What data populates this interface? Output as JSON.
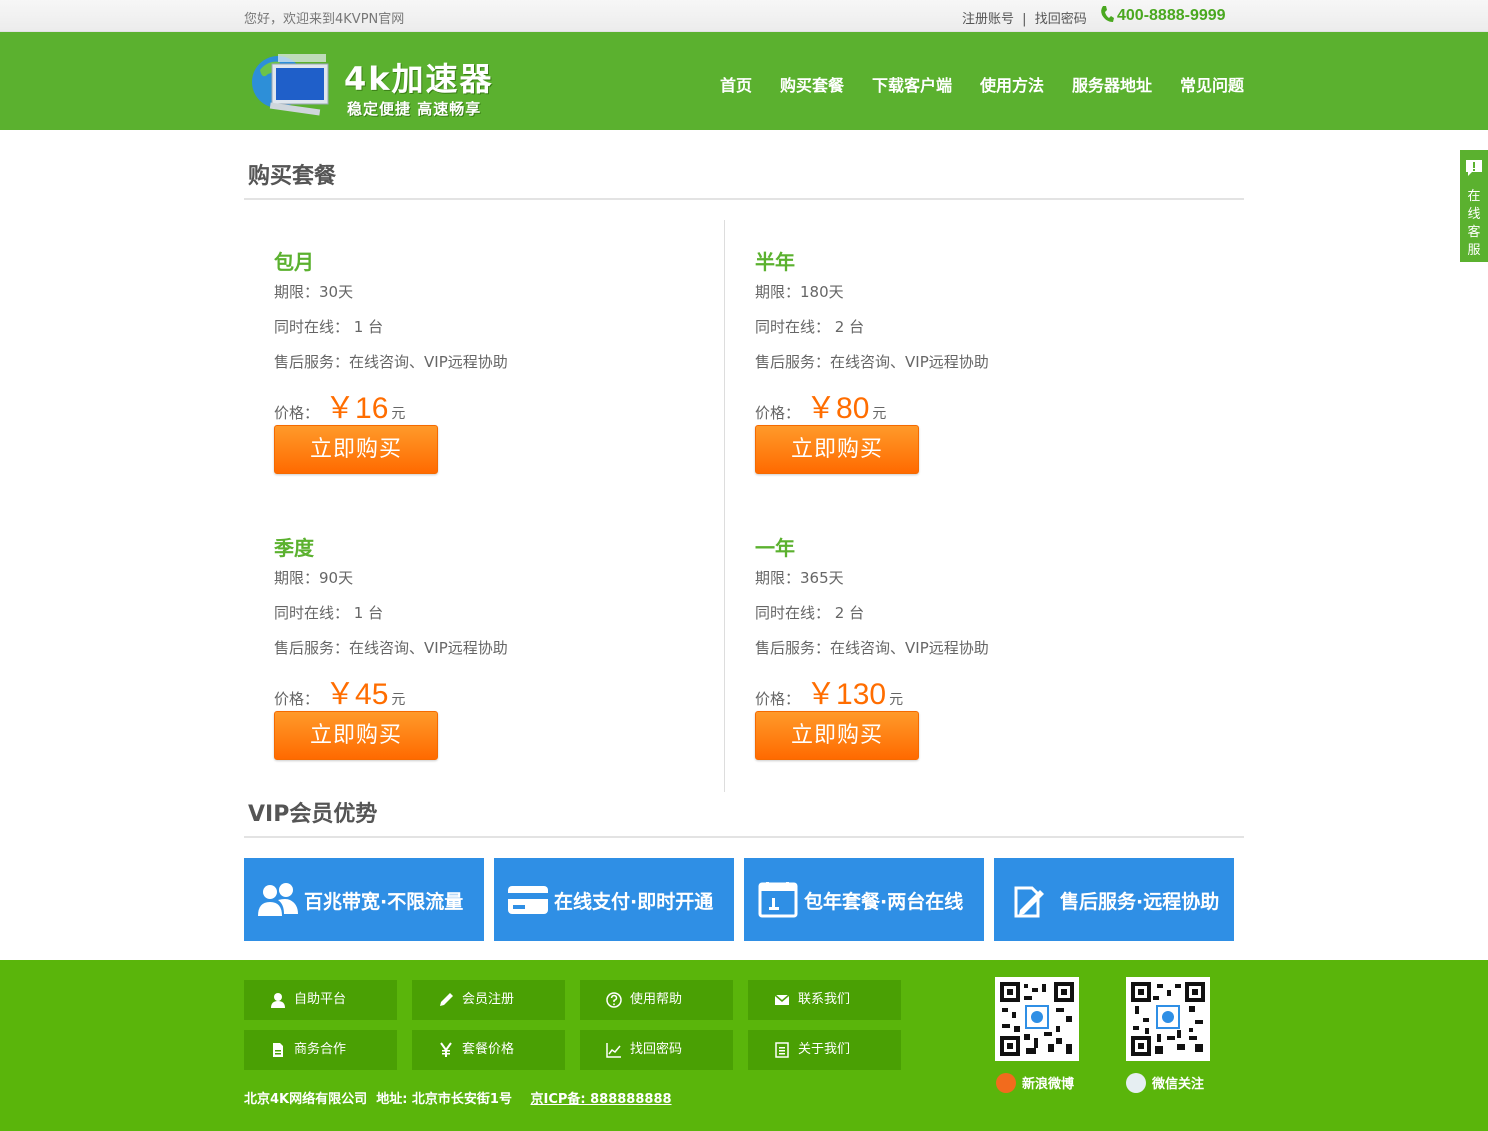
{
  "topbar": {
    "welcome": "您好，欢迎来到4KVPN官网",
    "register": "注册账号",
    "separator": "|",
    "recover": "找回密码",
    "phone": "400-8888-9999"
  },
  "header": {
    "brand": "4k加速器",
    "slogan": "稳定便捷 高速畅享",
    "nav": [
      "首页",
      "购买套餐",
      "下载客户端",
      "使用方法",
      "服务器地址",
      "常见问题"
    ]
  },
  "side": {
    "label": "在线客服"
  },
  "purchase": {
    "title": "购买套餐",
    "period_prefix": "期限：",
    "online_prefix": "同时在线：",
    "service_prefix": "售后服务：",
    "price_prefix": "价格：",
    "currency": "￥",
    "unit": "元",
    "device_unit": "台",
    "button": "立即购买",
    "plans": [
      {
        "name": "包月",
        "period": "30天",
        "online": "1",
        "service": "在线咨询、VIP远程协助",
        "price": "16"
      },
      {
        "name": "半年",
        "period": "180天",
        "online": "2",
        "service": "在线咨询、VIP远程协助",
        "price": "80"
      },
      {
        "name": "季度",
        "period": "90天",
        "online": "1",
        "service": "在线咨询、VIP远程协助",
        "price": "45"
      },
      {
        "name": "一年",
        "period": "365天",
        "online": "2",
        "service": "在线咨询、VIP远程协助",
        "price": "130"
      }
    ]
  },
  "vip": {
    "title": "VIP会员优势",
    "items": [
      {
        "label": "百兆带宽·不限流量",
        "icon": "users-icon"
      },
      {
        "label": "在线支付·即时开通",
        "icon": "card-icon"
      },
      {
        "label": "包年套餐·两台在线",
        "icon": "calendar-icon"
      },
      {
        "label": "售后服务·远程协助",
        "icon": "edit-icon"
      }
    ]
  },
  "footer": {
    "links": [
      {
        "label": "自助平台",
        "icon": "user-icon"
      },
      {
        "label": "会员注册",
        "icon": "pencil-icon"
      },
      {
        "label": "使用帮助",
        "icon": "help-icon"
      },
      {
        "label": "联系我们",
        "icon": "mail-icon"
      },
      {
        "label": "商务合作",
        "icon": "doc-icon"
      },
      {
        "label": "套餐价格",
        "icon": "yen-icon"
      },
      {
        "label": "找回密码",
        "icon": "chart-icon"
      },
      {
        "label": "关于我们",
        "icon": "list-icon"
      }
    ],
    "company": "北京4K网络有限公司",
    "address": "地址: 北京市长安街1号",
    "icp": "京ICP备: 888888888",
    "weibo": "新浪微博",
    "wechat": "微信关注"
  },
  "colors": {
    "green": "#5bb12f",
    "orange": "#ff6d00",
    "blue": "#2f8fe5",
    "footer_green": "#5ab50b"
  }
}
